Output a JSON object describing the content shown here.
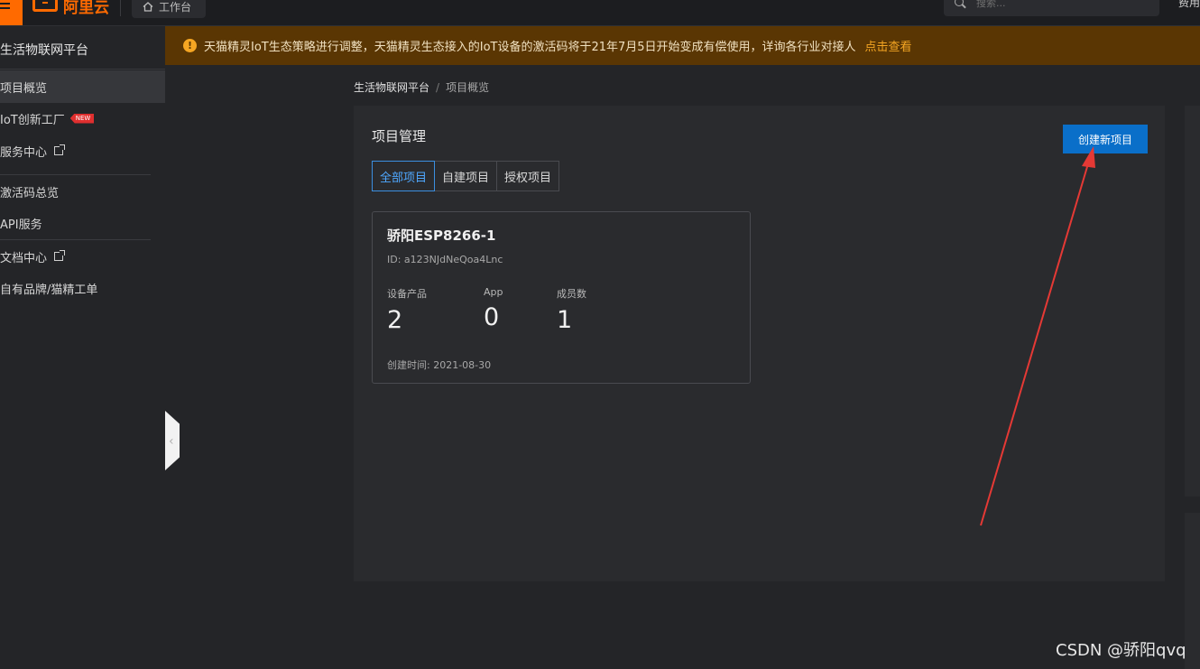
{
  "topbar": {
    "logo_text": "阿里云",
    "workbench_label": "工作台",
    "search_placeholder": "搜索...",
    "right_text": "费用"
  },
  "sidebar": {
    "title": "生活物联网平台",
    "items": [
      {
        "label": "项目概览",
        "active": true
      },
      {
        "label": "IoT创新工厂",
        "badge": "NEW"
      },
      {
        "label": "服务中心",
        "external": true
      },
      {
        "label": "激活码总览"
      },
      {
        "label": "API服务"
      },
      {
        "label": "文档中心",
        "external": true
      },
      {
        "label": "自有品牌/猫精工单"
      }
    ]
  },
  "notice": {
    "text": "天猫精灵IoT生态策略进行调整，天猫精灵生态接入的IoT设备的激活码将于21年7月5日开始变成有偿使用，详询各行业对接人",
    "link": "点击查看"
  },
  "breadcrumb": [
    "生活物联网平台",
    "项目概览"
  ],
  "main": {
    "section_title": "项目管理",
    "create_button": "创建新项目",
    "tabs": [
      "全部项目",
      "自建项目",
      "授权项目"
    ],
    "active_tab": 0,
    "project": {
      "name": "骄阳ESP8266-1",
      "id": "ID: a123NJdNeQoa4Lnc",
      "stats": [
        {
          "label": "设备产品",
          "value": "2"
        },
        {
          "label": "App",
          "value": "0"
        },
        {
          "label": "成员数",
          "value": "1"
        }
      ],
      "created": "创建时间: 2021-08-30"
    }
  },
  "watermark": "CSDN @骄阳qvq",
  "colors": {
    "accent": "#ff6a00",
    "primary_button": "#0a6fc9",
    "notice_bg": "#5a3603",
    "annotation_arrow": "#e53935"
  }
}
